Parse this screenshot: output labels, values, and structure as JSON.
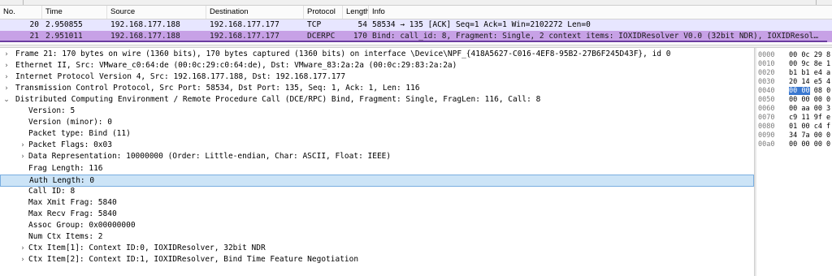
{
  "columns": {
    "no": "No.",
    "time": "Time",
    "source": "Source",
    "destination": "Destination",
    "protocol": "Protocol",
    "length": "Length",
    "info": "Info"
  },
  "packets": [
    {
      "no": "20",
      "time": "2.950855",
      "source": "192.168.177.188",
      "destination": "192.168.177.177",
      "protocol": "TCP",
      "length": "54",
      "info": "58534 → 135 [ACK] Seq=1 Ack=1 Win=2102272 Len=0",
      "color": "#e7e6ff"
    },
    {
      "no": "21",
      "time": "2.951011",
      "source": "192.168.177.188",
      "destination": "192.168.177.177",
      "protocol": "DCERPC",
      "length": "170",
      "info": "Bind: call_id: 8, Fragment: Single, 2 context items: IOXIDResolver V0.0 (32bit NDR), IOXIDResol…",
      "color": "#c7a1e6",
      "selected": true
    }
  ],
  "details": [
    {
      "text": "Frame 21: 170 bytes on wire (1360 bits), 170 bytes captured (1360 bits) on interface \\Device\\NPF_{418A5627-C016-4EF8-95B2-27B6F245D43F}, id 0",
      "arrow": "collapsed",
      "indent": 0
    },
    {
      "text": "Ethernet II, Src: VMware_c0:64:de (00:0c:29:c0:64:de), Dst: VMware_83:2a:2a (00:0c:29:83:2a:2a)",
      "arrow": "collapsed",
      "indent": 0
    },
    {
      "text": "Internet Protocol Version 4, Src: 192.168.177.188, Dst: 192.168.177.177",
      "arrow": "collapsed",
      "indent": 0
    },
    {
      "text": "Transmission Control Protocol, Src Port: 58534, Dst Port: 135, Seq: 1, Ack: 1, Len: 116",
      "arrow": "collapsed",
      "indent": 0
    },
    {
      "text": "Distributed Computing Environment / Remote Procedure Call (DCE/RPC) Bind, Fragment: Single, FragLen: 116, Call: 8",
      "arrow": "expanded",
      "indent": 0
    },
    {
      "text": "Version: 5",
      "arrow": "none",
      "indent": 1
    },
    {
      "text": "Version (minor): 0",
      "arrow": "none",
      "indent": 1
    },
    {
      "text": "Packet type: Bind (11)",
      "arrow": "none",
      "indent": 1
    },
    {
      "text": "Packet Flags: 0x03",
      "arrow": "collapsed",
      "indent": 1
    },
    {
      "text": "Data Representation: 10000000 (Order: Little-endian, Char: ASCII, Float: IEEE)",
      "arrow": "collapsed",
      "indent": 1
    },
    {
      "text": "Frag Length: 116",
      "arrow": "none",
      "indent": 1
    },
    {
      "text": "Auth Length: 0",
      "arrow": "none",
      "indent": 1,
      "selected": true
    },
    {
      "text": "Call ID: 8",
      "arrow": "none",
      "indent": 1
    },
    {
      "text": "Max Xmit Frag: 5840",
      "arrow": "none",
      "indent": 1
    },
    {
      "text": "Max Recv Frag: 5840",
      "arrow": "none",
      "indent": 1
    },
    {
      "text": "Assoc Group: 0x00000000",
      "arrow": "none",
      "indent": 1
    },
    {
      "text": "Num Ctx Items: 2",
      "arrow": "none",
      "indent": 1
    },
    {
      "text": "Ctx Item[1]: Context ID:0, IOXIDResolver, 32bit NDR",
      "arrow": "collapsed",
      "indent": 1
    },
    {
      "text": "Ctx Item[2]: Context ID:1, IOXIDResolver, Bind Time Feature Negotiation",
      "arrow": "collapsed",
      "indent": 1
    }
  ],
  "bytes": [
    {
      "offset": "0000",
      "hex": "00 0c 29 8"
    },
    {
      "offset": "0010",
      "hex": "00 9c 8e 1"
    },
    {
      "offset": "0020",
      "hex": "b1 b1 e4 a"
    },
    {
      "offset": "0030",
      "hex": "20 14 e5 4"
    },
    {
      "offset": "0040",
      "hex_hl": "00 00",
      "hex_rest": " 08 0"
    },
    {
      "offset": "0050",
      "hex": "00 00 00 0"
    },
    {
      "offset": "0060",
      "hex": "00 aa 00 3"
    },
    {
      "offset": "0070",
      "hex": "c9 11 9f e"
    },
    {
      "offset": "0080",
      "hex": "01 00 c4 f"
    },
    {
      "offset": "0090",
      "hex": "34 7a 00 0"
    },
    {
      "offset": "00a0",
      "hex": "00 00 00 0"
    }
  ],
  "icons": {
    "collapsed": "›",
    "expanded": "⌄"
  },
  "colors": {
    "tcp_row": "#e7e6ff",
    "dcerpc_row": "#c7a1e6",
    "selection": "#cce4f7",
    "byte_highlight": "#3a78d0"
  }
}
